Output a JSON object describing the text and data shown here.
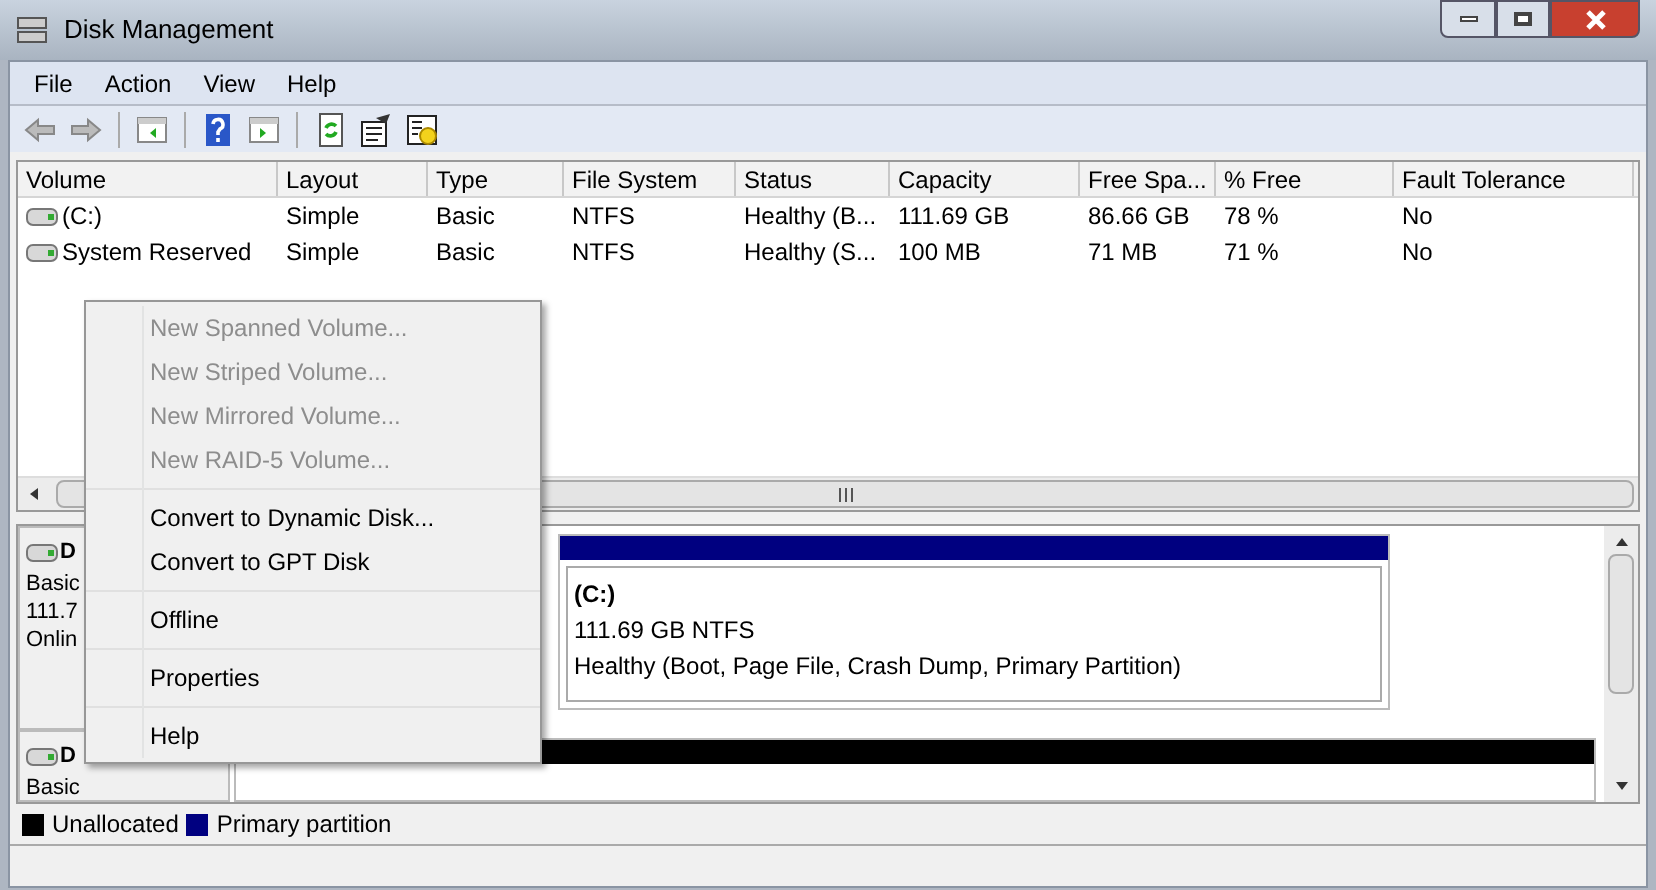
{
  "window": {
    "title": "Disk Management"
  },
  "menu_bar": [
    "File",
    "Action",
    "View",
    "Help"
  ],
  "volume_table": {
    "columns": [
      "Volume",
      "Layout",
      "Type",
      "File System",
      "Status",
      "Capacity",
      "Free Spa...",
      "% Free",
      "Fault Tolerance"
    ],
    "rows": [
      [
        "(C:)",
        "Simple",
        "Basic",
        "NTFS",
        "Healthy (B...",
        "111.69 GB",
        "86.66 GB",
        "78 %",
        "No"
      ],
      [
        "System Reserved",
        "Simple",
        "Basic",
        "NTFS",
        "Healthy (S...",
        "100 MB",
        "71 MB",
        "71 %",
        "No"
      ]
    ]
  },
  "disks": [
    {
      "name": "D",
      "lines": [
        "Basic",
        "111.7",
        "Onlin"
      ],
      "partitions": [
        {
          "kind": "primary",
          "label": "(C:)",
          "size": "111.69 GB NTFS",
          "status": "Healthy (Boot, Page File, Crash Dump, Primary Partition)"
        }
      ]
    },
    {
      "name": "D",
      "lines": [
        "Basic"
      ],
      "partitions": [
        {
          "kind": "unallocated"
        }
      ]
    }
  ],
  "legend": [
    {
      "label": "Unallocated",
      "color": "#000000"
    },
    {
      "label": "Primary partition",
      "color": "#000080"
    }
  ],
  "context_menu": [
    [
      {
        "label": "New Spanned Volume...",
        "disabled": true
      },
      {
        "label": "New Striped Volume...",
        "disabled": true
      },
      {
        "label": "New Mirrored Volume...",
        "disabled": true
      },
      {
        "label": "New RAID-5 Volume...",
        "disabled": true
      }
    ],
    [
      {
        "label": "Convert to Dynamic Disk...",
        "disabled": false
      },
      {
        "label": "Convert to GPT Disk",
        "disabled": false
      }
    ],
    [
      {
        "label": "Offline",
        "disabled": false
      }
    ],
    [
      {
        "label": "Properties",
        "disabled": false
      }
    ],
    [
      {
        "label": "Help",
        "disabled": false
      }
    ]
  ]
}
